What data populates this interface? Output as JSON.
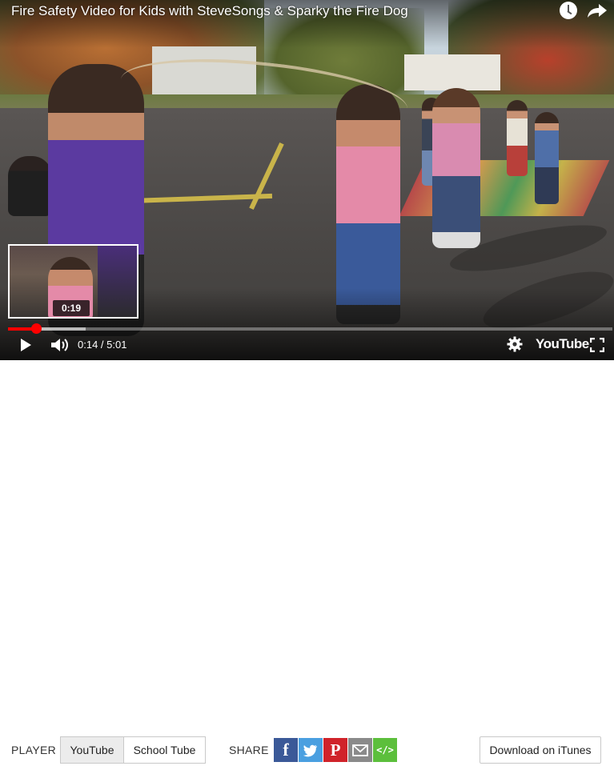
{
  "video": {
    "title": "Fire Safety Video for Kids with SteveSongs & Sparky the Fire Dog",
    "preview_time": "0:19",
    "time_display": "0:14 / 5:01",
    "progress_played_fraction": 0.047,
    "progress_loaded_fraction": 0.129,
    "logo_text": "YouTube"
  },
  "icons": {
    "watch_later": "clock-icon",
    "share": "share-arrow-icon",
    "play": "play-icon",
    "volume": "volume-icon",
    "settings": "gear-icon",
    "fullscreen": "fullscreen-icon"
  },
  "toolbar": {
    "player_label": "PLAYER",
    "player_options": [
      "YouTube",
      "School Tube"
    ],
    "player_selected": "YouTube",
    "share_label": "SHARE",
    "share_buttons": [
      {
        "name": "facebook",
        "glyph": "f",
        "color": "#3b5998"
      },
      {
        "name": "twitter",
        "glyph": "",
        "color": "#4a9fe0"
      },
      {
        "name": "pinterest",
        "glyph": "P",
        "color": "#d0232a"
      },
      {
        "name": "email",
        "glyph": "",
        "color": "#8a8a8a"
      },
      {
        "name": "embed",
        "glyph": "</>",
        "color": "#5cbf3c"
      }
    ],
    "itunes_label": "Download on iTunes"
  },
  "colors": {
    "progress": "#ff0000",
    "accent_active_bg": "#ececec"
  }
}
